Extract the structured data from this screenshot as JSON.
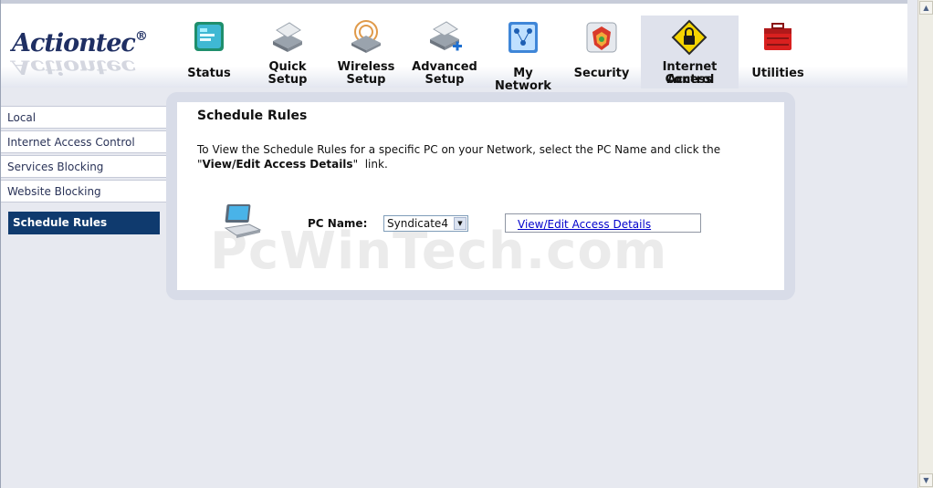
{
  "brand": {
    "name": "Actiontec",
    "mark": "®",
    "reflection": "Actiontec"
  },
  "nav": [
    {
      "line1": "Status",
      "line2": "",
      "icon": "status-icon"
    },
    {
      "line1": "Quick",
      "line2": "Setup",
      "icon": "quick-setup-icon"
    },
    {
      "line1": "Wireless",
      "line2": "Setup",
      "icon": "wireless-setup-icon"
    },
    {
      "line1": "Advanced",
      "line2": "Setup",
      "icon": "advanced-setup-icon"
    },
    {
      "line1": "My Network",
      "line2": "",
      "icon": "my-network-icon"
    },
    {
      "line1": "Security",
      "line2": "",
      "icon": "security-icon"
    },
    {
      "line1": "Internet Access",
      "line2": "Control",
      "icon": "lock-warning-icon",
      "active": true
    },
    {
      "line1": "Utilities",
      "line2": "",
      "icon": "toolbox-icon"
    }
  ],
  "sidebar": {
    "items": [
      "Local",
      "Internet Access Control",
      "Services Blocking",
      "Website Blocking"
    ],
    "active": "Schedule Rules"
  },
  "main": {
    "title": "Schedule Rules",
    "desc_text": "To View the Schedule Rules for a specific PC on your Network, select the PC Name and click the",
    "desc_link_name": "View/Edit Access Details",
    "desc_suffix": "link.",
    "pc_label": "PC Name:",
    "pc_selected": "Syndicate4",
    "details_link": "View/Edit Access Details"
  },
  "watermark": "PcWinTech.com",
  "colors": {
    "accent": "#0f3a6e",
    "background": "#e7e9f0",
    "link": "#0000cc"
  }
}
